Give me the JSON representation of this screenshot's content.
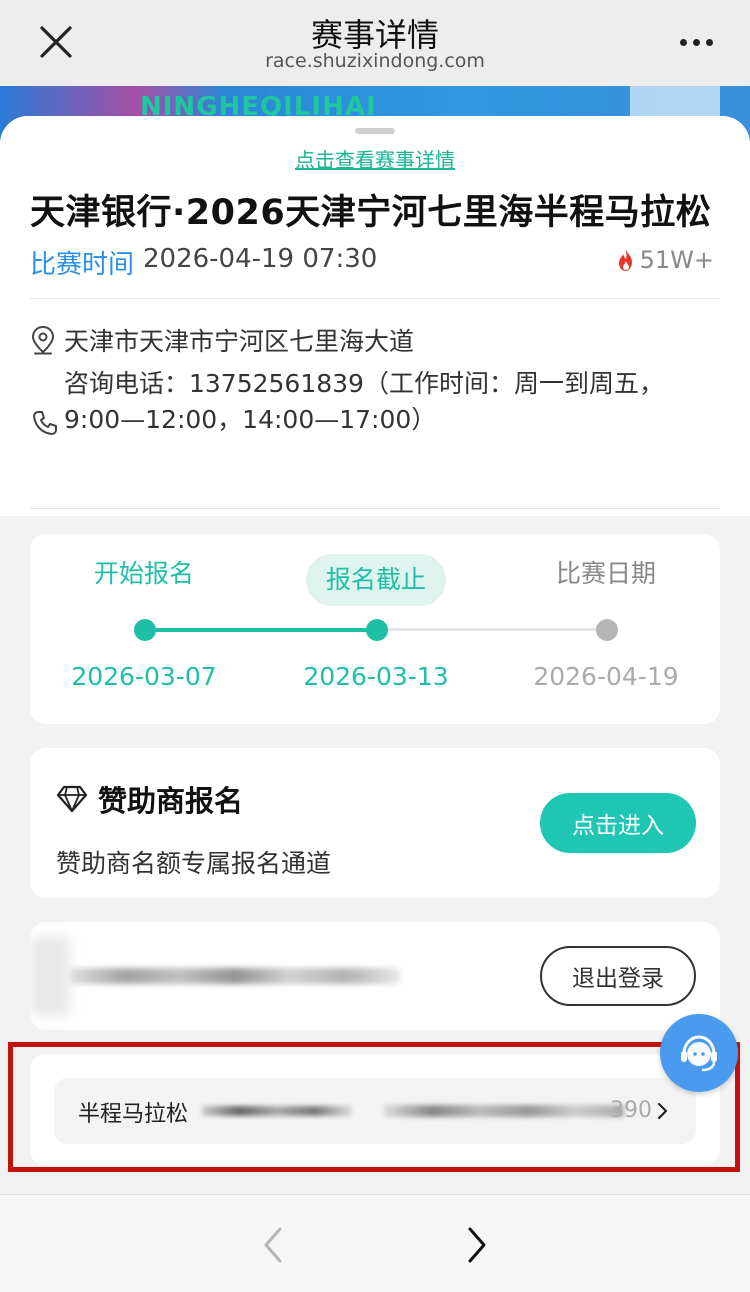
{
  "nav": {
    "title": "赛事详情",
    "url": "race.shuzixindong.com",
    "close_icon": "close-icon",
    "more_icon": "more-icon"
  },
  "banner": {
    "text": "NINGHEQILIHAI"
  },
  "event": {
    "detail_link": "点击查看赛事详情",
    "title": "天津银行·2026天津宁河七里海半程马拉松",
    "time_label": "比赛时间",
    "time_value": "2026-04-19 07:30",
    "heat": "51W+",
    "address": "天津市天津市宁河区七里海大道",
    "phone": "咨询电话：13752561839（工作时间：周一到周五，9:00—12:00，14:00—17:00）"
  },
  "timeline": {
    "steps": [
      {
        "label": "开始报名",
        "date": "2026-03-07",
        "state": "done"
      },
      {
        "label": "报名截止",
        "date": "2026-03-13",
        "state": "current"
      },
      {
        "label": "比赛日期",
        "date": "2026-04-19",
        "state": "pending"
      }
    ],
    "colors": {
      "active": "#1fbfa7",
      "pending": "#b5b5b5"
    }
  },
  "sponsor": {
    "title": "赞助商报名",
    "subtitle": "赞助商名额专属报名通道",
    "button": "点击进入",
    "icon": "diamond-icon"
  },
  "account": {
    "logout_button": "退出登录"
  },
  "registration": {
    "label": "半程马拉松",
    "tail": "390"
  },
  "bottom_nav": {
    "back_icon": "chevron-left-icon",
    "forward_icon": "chevron-right-icon"
  },
  "colors": {
    "accent": "#1fbfa7",
    "link_blue": "#2a8fe8",
    "highlight": "#c0140c"
  }
}
